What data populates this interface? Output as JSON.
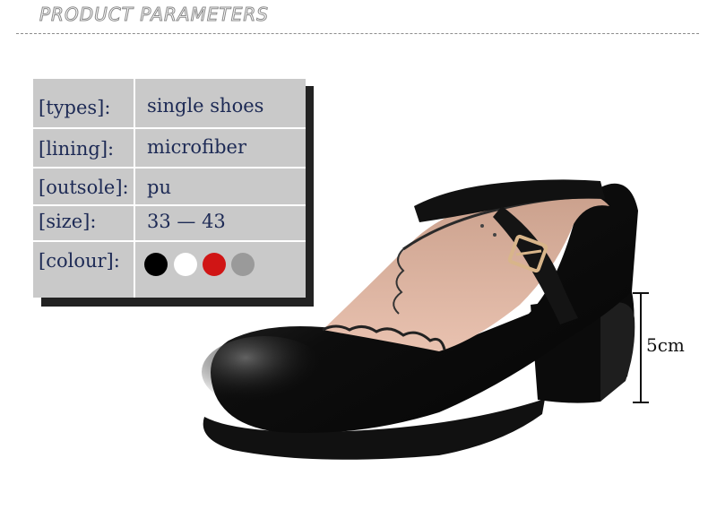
{
  "header": {
    "title": "PRODUCT PARAMETERS"
  },
  "params": [
    {
      "label": "[types]:",
      "value": "single shoes"
    },
    {
      "label": "[lining]:",
      "value": "microfiber"
    },
    {
      "label": "[outsole]:",
      "value": "pu"
    },
    {
      "label": "[size]:",
      "value": "33 — 43"
    },
    {
      "label": "[colour]:",
      "value": ""
    }
  ],
  "colours": [
    "#000000",
    "#ffffff",
    "#d01515",
    "#9a9a9a"
  ],
  "measurement": {
    "label": "5cm"
  }
}
